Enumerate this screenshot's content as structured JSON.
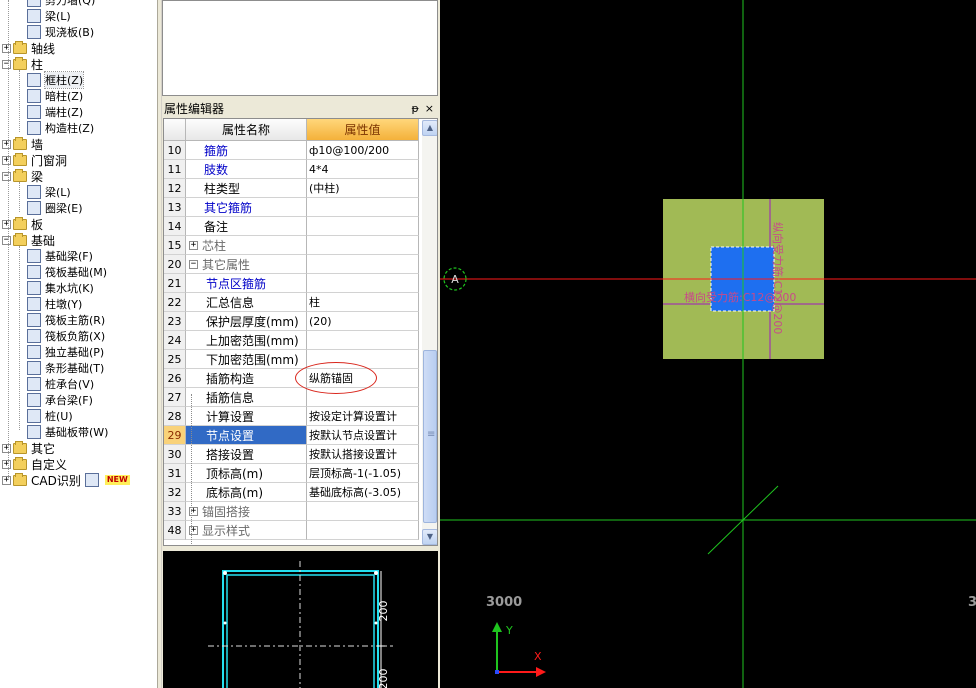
{
  "tree": {
    "items": [
      {
        "label": "剪力墙(Q)",
        "level": 2,
        "icon": "wall-icon"
      },
      {
        "label": "梁(L)",
        "level": 2,
        "icon": "beam-icon"
      },
      {
        "label": "现浇板(B)",
        "level": 2,
        "icon": "slab-icon"
      },
      {
        "label": "轴线",
        "level": 0,
        "expander": "+"
      },
      {
        "label": "柱",
        "level": 0,
        "expander": "-"
      },
      {
        "label": "框柱(Z)",
        "level": 1,
        "icon": "column-icon",
        "selected": true
      },
      {
        "label": "暗柱(Z)",
        "level": 1,
        "icon": "column-icon"
      },
      {
        "label": "端柱(Z)",
        "level": 1,
        "icon": "column-icon"
      },
      {
        "label": "构造柱(Z)",
        "level": 1,
        "icon": "column-icon"
      },
      {
        "label": "墙",
        "level": 0,
        "expander": "+"
      },
      {
        "label": "门窗洞",
        "level": 0,
        "expander": "+"
      },
      {
        "label": "梁",
        "level": 0,
        "expander": "-"
      },
      {
        "label": "梁(L)",
        "level": 1,
        "icon": "beam-icon"
      },
      {
        "label": "圈梁(E)",
        "level": 1,
        "icon": "ring-beam-icon"
      },
      {
        "label": "板",
        "level": 0,
        "expander": "+"
      },
      {
        "label": "基础",
        "level": 0,
        "expander": "-"
      },
      {
        "label": "基础梁(F)",
        "level": 1,
        "icon": "foundation-beam-icon"
      },
      {
        "label": "筏板基础(M)",
        "level": 1,
        "icon": "raft-icon"
      },
      {
        "label": "集水坑(K)",
        "level": 1,
        "icon": "sump-icon"
      },
      {
        "label": "柱墩(Y)",
        "level": 1,
        "icon": "pier-icon"
      },
      {
        "label": "筏板主筋(R)",
        "level": 1,
        "icon": "raft-rebar-icon"
      },
      {
        "label": "筏板负筋(X)",
        "level": 1,
        "icon": "raft-neg-rebar-icon"
      },
      {
        "label": "独立基础(P)",
        "level": 1,
        "icon": "isolated-footing-icon"
      },
      {
        "label": "条形基础(T)",
        "level": 1,
        "icon": "strip-footing-icon"
      },
      {
        "label": "桩承台(V)",
        "level": 1,
        "icon": "pile-cap-icon"
      },
      {
        "label": "承台梁(F)",
        "level": 1,
        "icon": "cap-beam-icon"
      },
      {
        "label": "桩(U)",
        "level": 1,
        "icon": "pile-icon"
      },
      {
        "label": "基础板带(W)",
        "level": 1,
        "icon": "foundation-strip-icon"
      },
      {
        "label": "其它",
        "level": 0,
        "expander": "+"
      },
      {
        "label": "自定义",
        "level": 0,
        "expander": "+"
      },
      {
        "label": "CAD识别",
        "level": 0,
        "expander": "+",
        "badge": "NEW"
      }
    ]
  },
  "property_editor": {
    "title": "属性编辑器",
    "pin": "ᵽ",
    "close": "×",
    "col_name": "属性名称",
    "col_value": "属性值",
    "rows": [
      {
        "num": "10",
        "name": "箍筋",
        "value": "ф10@100/200",
        "style": "blue",
        "indent": "ind0"
      },
      {
        "num": "11",
        "name": "肢数",
        "value": "4*4",
        "style": "blue",
        "indent": "ind0"
      },
      {
        "num": "12",
        "name": "柱类型",
        "value": "(中柱)",
        "style": "",
        "indent": "ind0"
      },
      {
        "num": "13",
        "name": "其它箍筋",
        "value": "",
        "style": "blue",
        "indent": "ind0"
      },
      {
        "num": "14",
        "name": "备注",
        "value": "",
        "style": "",
        "indent": "ind0"
      },
      {
        "num": "15",
        "name": "芯柱",
        "value": "",
        "style": "gray",
        "expander": "+"
      },
      {
        "num": "20",
        "name": "其它属性",
        "value": "",
        "style": "gray",
        "expander": "-"
      },
      {
        "num": "21",
        "name": "节点区箍筋",
        "value": "",
        "style": "blue",
        "indent": "ind1"
      },
      {
        "num": "22",
        "name": "汇总信息",
        "value": "柱",
        "style": "",
        "indent": "ind1"
      },
      {
        "num": "23",
        "name": "保护层厚度(mm)",
        "value": "(20)",
        "style": "",
        "indent": "ind1"
      },
      {
        "num": "24",
        "name": "上加密范围(mm)",
        "value": "",
        "style": "",
        "indent": "ind1"
      },
      {
        "num": "25",
        "name": "下加密范围(mm)",
        "value": "",
        "style": "",
        "indent": "ind1"
      },
      {
        "num": "26",
        "name": "插筋构造",
        "value": "纵筋锚固",
        "style": "",
        "indent": "ind1"
      },
      {
        "num": "27",
        "name": "插筋信息",
        "value": "",
        "style": "",
        "indent": "ind1"
      },
      {
        "num": "28",
        "name": "计算设置",
        "value": "按设定计算设置计",
        "style": "",
        "indent": "ind1"
      },
      {
        "num": "29",
        "name": "节点设置",
        "value": "按默认节点设置计",
        "style": "",
        "indent": "ind1",
        "selected": true
      },
      {
        "num": "30",
        "name": "搭接设置",
        "value": "按默认搭接设置计",
        "style": "",
        "indent": "ind1"
      },
      {
        "num": "31",
        "name": "顶标高(m)",
        "value": "层顶标高-1(-1.05)",
        "style": "",
        "indent": "ind1"
      },
      {
        "num": "32",
        "name": "底标高(m)",
        "value": "基础底标高(-3.05)",
        "style": "",
        "indent": "ind1"
      },
      {
        "num": "33",
        "name": "锚固搭接",
        "value": "",
        "style": "gray",
        "expander": "+"
      },
      {
        "num": "48",
        "name": "显示样式",
        "value": "",
        "style": "gray",
        "expander": "+"
      }
    ]
  },
  "mini_preview": {
    "dim_top": "200",
    "dim_bottom": "200",
    "line_color": "#24e0f0"
  },
  "canvas": {
    "axis_bubble": "A",
    "horizontal_rebar_label": "横向受力筋:C12@200",
    "vertical_rebar_label": "纵向受力筋:C12@200",
    "dim_left": "3000",
    "dim_right": "3",
    "ucs_y": "Y",
    "ucs_x": "X",
    "colors": {
      "background": "#000000",
      "slab": "#a1ba55",
      "column": "#1e6ff0",
      "red_axis": "#ff1a1a",
      "green_axis": "#1fc41f",
      "rebar_line": "#a06a8a"
    }
  }
}
